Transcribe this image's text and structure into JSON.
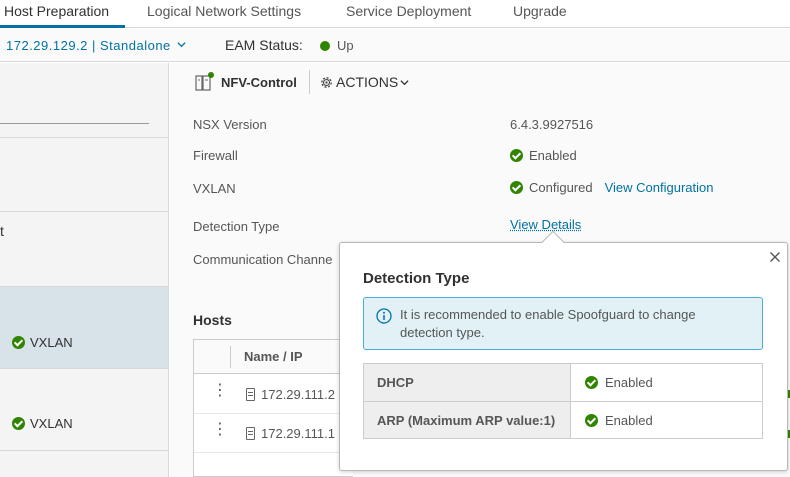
{
  "tabs": [
    {
      "label": "Host Preparation",
      "active": true
    },
    {
      "label": "Logical Network Settings",
      "active": false
    },
    {
      "label": "Service Deployment",
      "active": false
    },
    {
      "label": "Upgrade",
      "active": false
    }
  ],
  "hostbar": {
    "host_select": "172.29.129.2 | Standalone",
    "eam_label": "EAM Status:",
    "eam_value": "Up"
  },
  "left": {
    "row_label_partial": "t",
    "rows": [
      {
        "status": "VXLAN",
        "selected": true
      },
      {
        "status": "VXLAN",
        "selected": false
      }
    ]
  },
  "object": {
    "name": "NFV-Control",
    "actions_label": "ACTIONS"
  },
  "properties": [
    {
      "label": "NSX Version",
      "value": "6.4.3.9927516"
    },
    {
      "label": "Firewall",
      "value": "Enabled"
    },
    {
      "label": "VXLAN",
      "value": "Configured",
      "link": "View Configuration"
    },
    {
      "label": "Detection Type",
      "link": "View Details"
    },
    {
      "label": "Communication Channe"
    }
  ],
  "hosts": {
    "title": "Hosts",
    "column": "Name / IP",
    "rows": [
      {
        "ip": "172.29.111.2"
      },
      {
        "ip": "172.29.111.1"
      }
    ]
  },
  "popover": {
    "title": "Detection Type",
    "alert": "It is recommended to enable Spoofguard to change detection type.",
    "rows": [
      {
        "key": "DHCP",
        "value": "Enabled"
      },
      {
        "key": "ARP (Maximum ARP value:1)",
        "value": "Enabled"
      }
    ]
  },
  "colors": {
    "accent": "#0072a3",
    "success": "#2f8400",
    "info_bg": "#e1f1f6",
    "info_border": "#49afd9",
    "selected_row": "#d8e3e9"
  }
}
